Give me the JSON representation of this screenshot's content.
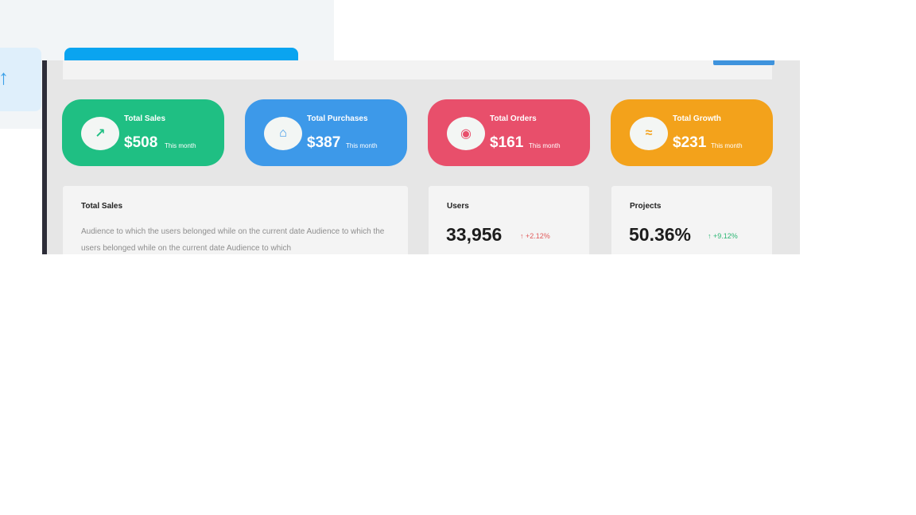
{
  "background": {
    "tab_icon": "partial-arrow-icon"
  },
  "colors": {
    "green": "#1fbf83",
    "blue": "#3d99e9",
    "red": "#e84f6b",
    "orange": "#f3a21b",
    "change_red": "#e05a5a",
    "change_green": "#2bb673"
  },
  "stats": [
    {
      "title": "Total Sales",
      "value": "$508",
      "period": "This month",
      "icon": "arrow-up-right-icon",
      "glyph": "↗"
    },
    {
      "title": "Total Purchases",
      "value": "$387",
      "period": "This month",
      "icon": "basket-icon",
      "glyph": "⌂"
    },
    {
      "title": "Total Orders",
      "value": "$161",
      "period": "This month",
      "icon": "globe-icon",
      "glyph": "◉"
    },
    {
      "title": "Total Growth",
      "value": "$231",
      "period": "This month",
      "icon": "growth-chart-icon",
      "glyph": "≈"
    }
  ],
  "total_sales_panel": {
    "title": "Total Sales",
    "text": "Audience to which the users belonged while on the current date Audience to which the users belonged while on the current date Audience to which"
  },
  "users_panel": {
    "title": "Users",
    "value": "33,956",
    "change": "↑ +2.12%"
  },
  "projects_panel": {
    "title": "Projects",
    "value": "50.36%",
    "change": "↑ +9.12%"
  }
}
